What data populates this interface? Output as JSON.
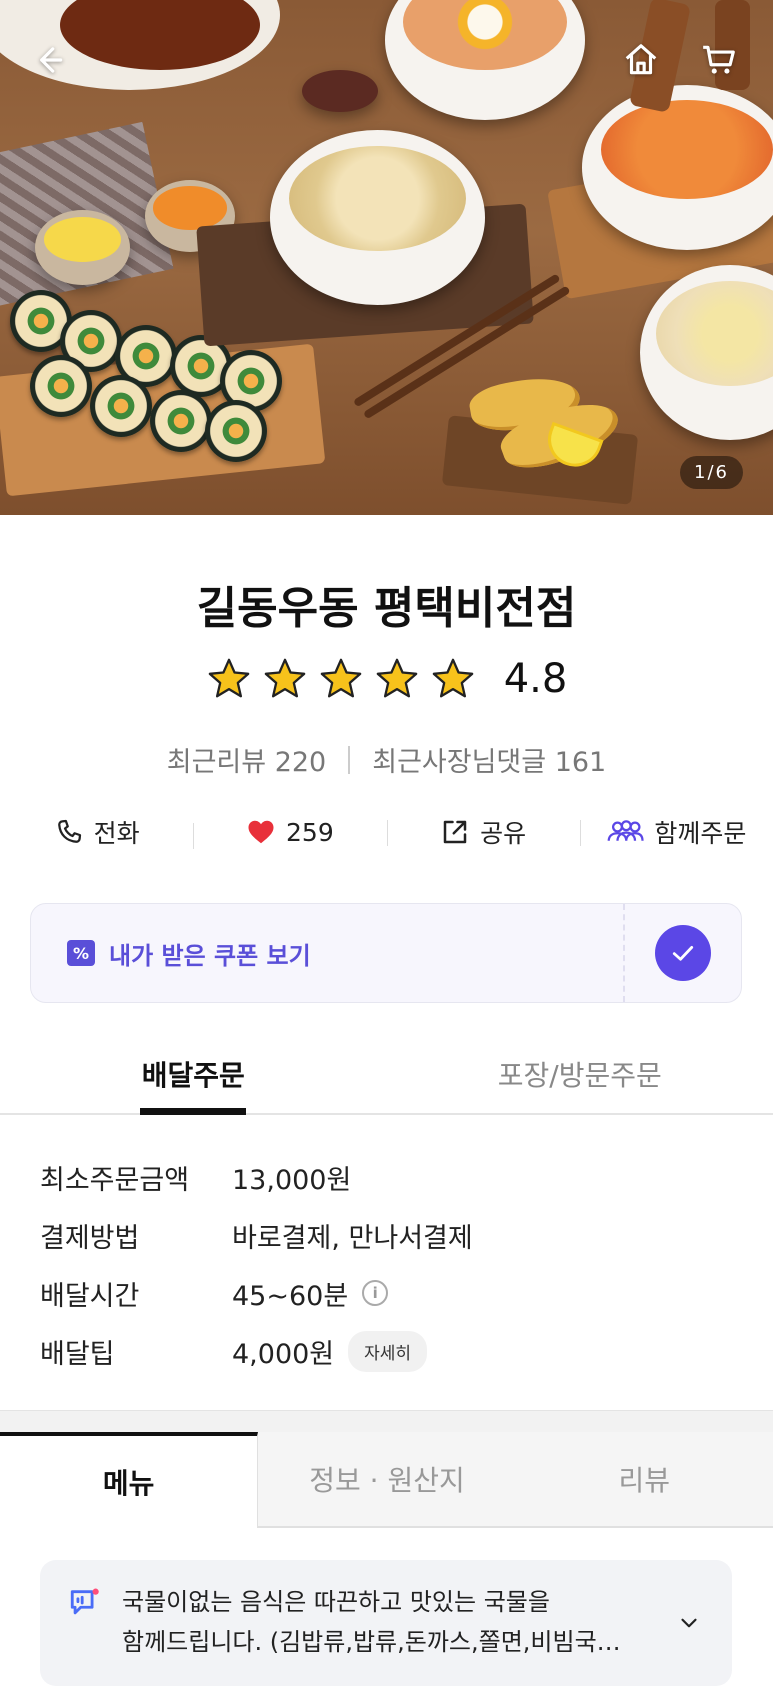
{
  "hero": {
    "page_indicator": "1/6"
  },
  "store": {
    "name": "길동우동 평택비전점",
    "rating": "4.8",
    "stars": 5,
    "recent_reviews": "최근리뷰 220",
    "owner_replies": "최근사장님댓글 161"
  },
  "actions": {
    "call": "전화",
    "likes": "259",
    "share": "공유",
    "group_order": "함께주문"
  },
  "coupon": {
    "label": "내가 받은 쿠폰 보기"
  },
  "order_tabs": [
    "배달주문",
    "포장/방문주문"
  ],
  "info": {
    "min_order_label": "최소주문금액",
    "min_order_value": "13,000원",
    "payment_label": "결제방법",
    "payment_value": "바로결제, 만나서결제",
    "delivery_time_label": "배달시간",
    "delivery_time_value": "45~60분",
    "delivery_tip_label": "배달팁",
    "delivery_tip_value": "4,000원",
    "detail_button": "자세히"
  },
  "menu_tabs": [
    "메뉴",
    "정보 · 원산지",
    "리뷰"
  ],
  "notice": {
    "line1": "국물이없는 음식은 따끈하고 맛있는 국물을",
    "line2": "함께드립니다. (김밥류,밥류,돈까스,쫄면,비빔국…"
  },
  "colors": {
    "accent": "#5b47e6",
    "star": "#f7c21b",
    "heart": "#e8303a"
  },
  "icons": [
    "back-arrow-icon",
    "home-icon",
    "cart-icon",
    "phone-icon",
    "heart-icon",
    "share-icon",
    "people-icon",
    "coupon-icon",
    "check-icon",
    "info-icon",
    "notice-icon",
    "chevron-down-icon"
  ]
}
